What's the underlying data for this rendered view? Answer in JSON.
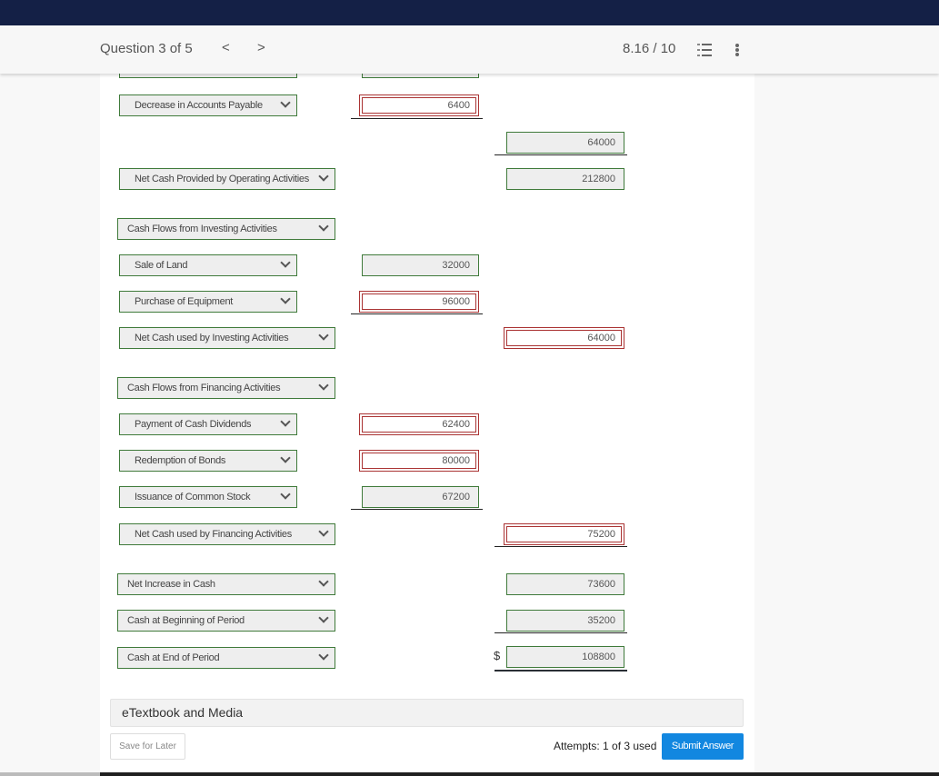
{
  "header": {
    "question_label": "Question 3 of 5",
    "prev_glyph": "<",
    "next_glyph": ">",
    "score": "8.16 / 10"
  },
  "rows": {
    "decrease_ap": {
      "label": "Decrease in Accounts Payable",
      "value": "6400",
      "status": "incorrect"
    },
    "op_subtotal": {
      "value": "64000",
      "status": "correct"
    },
    "net_operating": {
      "label": "Net Cash Provided by Operating Activities",
      "value": "212800",
      "status": "correct"
    },
    "investing_header": {
      "label": "Cash Flows from Investing Activities"
    },
    "sale_land": {
      "label": "Sale of Land",
      "value": "32000",
      "status": "correct"
    },
    "purchase_equipment": {
      "label": "Purchase of Equipment",
      "value": "96000",
      "status": "incorrect"
    },
    "net_investing": {
      "label": "Net Cash used by Investing Activities",
      "value": "64000",
      "status": "incorrect"
    },
    "financing_header": {
      "label": "Cash Flows from Financing Activities"
    },
    "cash_dividends": {
      "label": "Payment of Cash Dividends",
      "value": "62400",
      "status": "incorrect"
    },
    "redemption_bonds": {
      "label": "Redemption of Bonds",
      "value": "80000",
      "status": "incorrect"
    },
    "issuance_stock": {
      "label": "Issuance of Common Stock",
      "value": "67200",
      "status": "correct"
    },
    "net_financing": {
      "label": "Net Cash used by Financing Activities",
      "value": "75200",
      "status": "incorrect"
    },
    "net_increase": {
      "label": "Net Increase in Cash",
      "value": "73600",
      "status": "correct"
    },
    "cash_beginning": {
      "label": "Cash at Beginning of Period",
      "value": "35200",
      "status": "correct"
    },
    "cash_end": {
      "label": "Cash at End of Period",
      "value": "108800",
      "currency": "$",
      "status": "correct"
    }
  },
  "footer": {
    "etextbook_label": "eTextbook and Media",
    "save_label": "Save for Later",
    "attempts": "Attempts: 1 of 3 used",
    "submit_label": "Submit Answer"
  },
  "colors": {
    "topbar": "#142046",
    "correct_border": "#3f7a3a",
    "incorrect_border": "#aa3333",
    "submit": "#1287e0"
  }
}
